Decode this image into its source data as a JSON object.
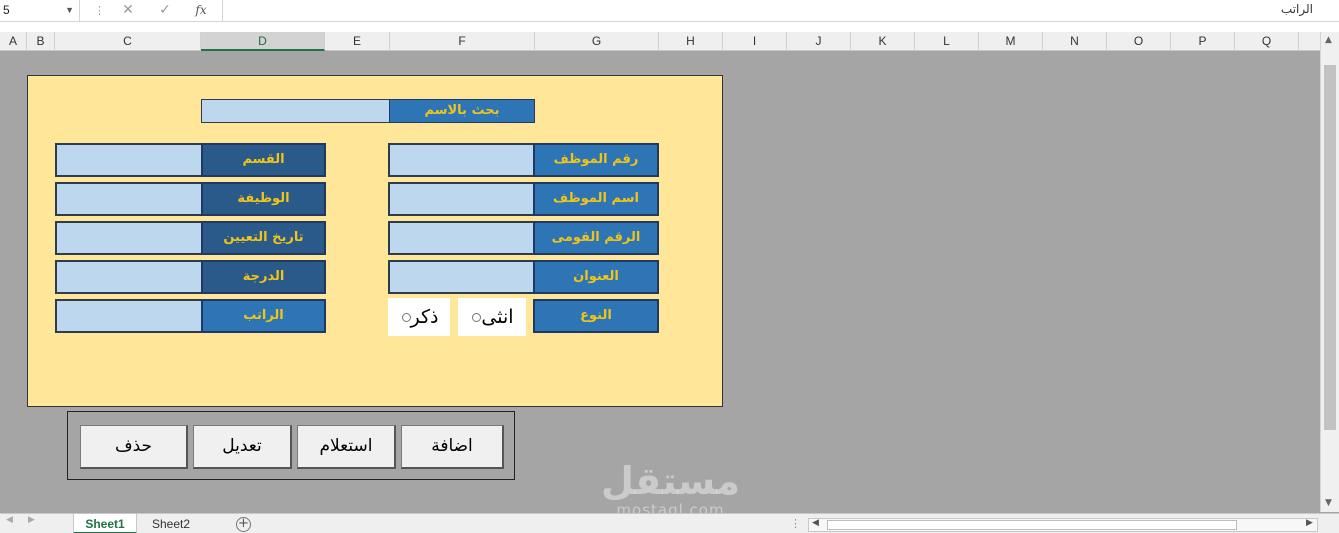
{
  "formula_bar": {
    "name_box": "5",
    "cancel_icon": "✕",
    "enter_icon": "✓",
    "fx_label": "fx",
    "content": "الراتب"
  },
  "columns": [
    "A",
    "B",
    "C",
    "D",
    "E",
    "F",
    "G",
    "H",
    "I",
    "J",
    "K",
    "L",
    "M",
    "N",
    "O",
    "P",
    "Q"
  ],
  "selected_column": "D",
  "form": {
    "search_label": "بحث بالاسم",
    "search_value": "",
    "right_labels": [
      "رقم الموظف",
      "اسم الموظف",
      "الرقم القومى",
      "العنوان",
      "النوع"
    ],
    "left_labels": [
      "القسم",
      "الوظيفة",
      "تاريخ التعيين",
      "الدرجة",
      "الراتب"
    ],
    "gender_options": [
      "انثى",
      "ذكر"
    ]
  },
  "buttons": {
    "add": "اضافة",
    "query": "استعلام",
    "edit": "تعديل",
    "delete": "حذف"
  },
  "watermark": {
    "brand": "مستقل",
    "domain": "mostaql.com"
  },
  "sheets": {
    "tabs": [
      "Sheet1",
      "Sheet2"
    ],
    "active": "Sheet1"
  },
  "icons": {
    "name_box_caret": "chevron-down-icon",
    "add_sheet": "plus-circle-icon"
  },
  "colors": {
    "label_blue": "#2e75b6",
    "label_dark": "#2a5a8a",
    "label_text": "#f0c419",
    "form_bg": "#ffe699",
    "input_bg": "#bdd7ee",
    "sheet_bg": "#a5a5a5"
  }
}
